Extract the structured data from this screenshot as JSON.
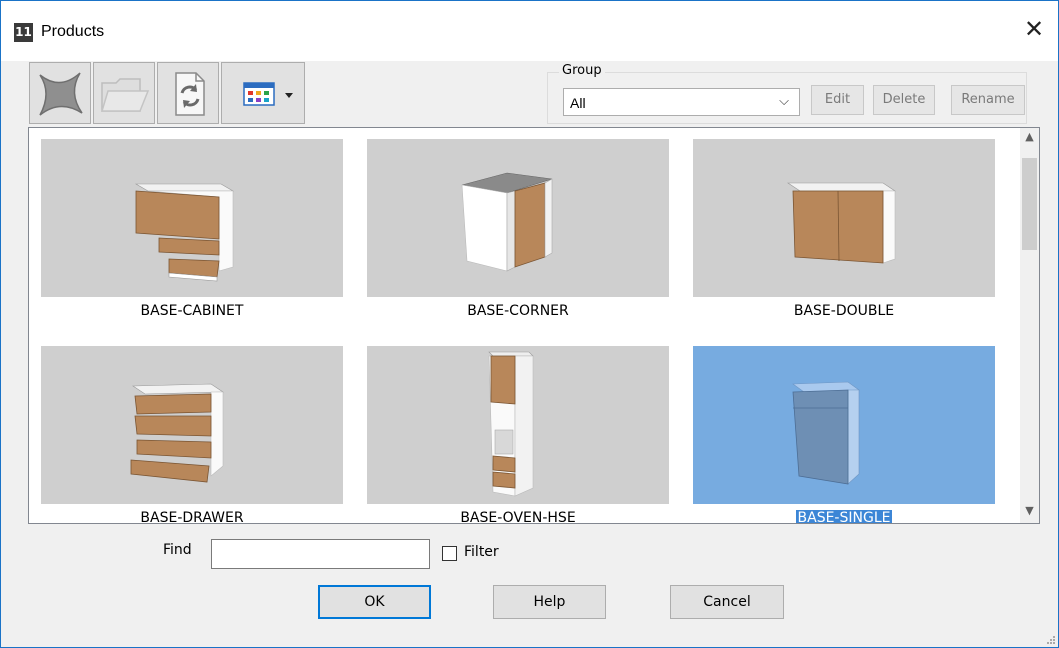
{
  "window": {
    "title": "Products",
    "app_icon_text": "11",
    "close_glyph": "✕"
  },
  "toolbar": {
    "buttons": [
      {
        "name": "delete-product-button",
        "icon": "x-cross-icon"
      },
      {
        "name": "open-folder-button",
        "icon": "folder-icon"
      },
      {
        "name": "refresh-button",
        "icon": "refresh-icon"
      },
      {
        "name": "view-mode-button",
        "icon": "grid-view-icon"
      }
    ]
  },
  "group": {
    "label": "Group",
    "selected": "All",
    "buttons": {
      "edit": "Edit",
      "delete": "Delete",
      "rename": "Rename"
    }
  },
  "products": [
    {
      "label": "BASE-CABINET",
      "selected": false
    },
    {
      "label": "BASE-CORNER",
      "selected": false
    },
    {
      "label": "BASE-DOUBLE",
      "selected": false
    },
    {
      "label": "BASE-DRAWER",
      "selected": false
    },
    {
      "label": "BASE-OVEN-HSE",
      "selected": false
    },
    {
      "label": "BASE-SINGLE",
      "selected": true
    }
  ],
  "find": {
    "label": "Find",
    "value": ""
  },
  "filter": {
    "label": "Filter",
    "checked": false
  },
  "actions": {
    "ok": "OK",
    "help": "Help",
    "cancel": "Cancel"
  },
  "colors": {
    "accent": "#0078d7",
    "selection": "#77abe0",
    "wood": "#b8875a"
  }
}
